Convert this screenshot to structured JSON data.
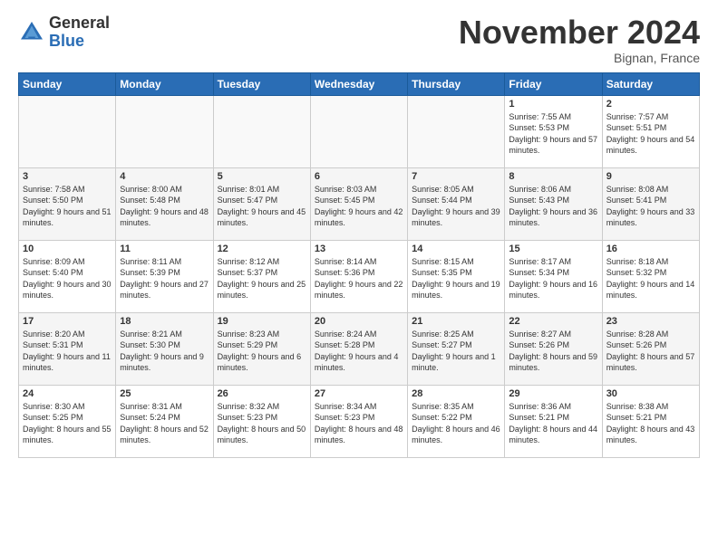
{
  "header": {
    "logo_general": "General",
    "logo_blue": "Blue",
    "month_title": "November 2024",
    "location": "Bignan, France"
  },
  "weekdays": [
    "Sunday",
    "Monday",
    "Tuesday",
    "Wednesday",
    "Thursday",
    "Friday",
    "Saturday"
  ],
  "weeks": [
    [
      {
        "day": "",
        "info": ""
      },
      {
        "day": "",
        "info": ""
      },
      {
        "day": "",
        "info": ""
      },
      {
        "day": "",
        "info": ""
      },
      {
        "day": "",
        "info": ""
      },
      {
        "day": "1",
        "info": "Sunrise: 7:55 AM\nSunset: 5:53 PM\nDaylight: 9 hours and 57 minutes."
      },
      {
        "day": "2",
        "info": "Sunrise: 7:57 AM\nSunset: 5:51 PM\nDaylight: 9 hours and 54 minutes."
      }
    ],
    [
      {
        "day": "3",
        "info": "Sunrise: 7:58 AM\nSunset: 5:50 PM\nDaylight: 9 hours and 51 minutes."
      },
      {
        "day": "4",
        "info": "Sunrise: 8:00 AM\nSunset: 5:48 PM\nDaylight: 9 hours and 48 minutes."
      },
      {
        "day": "5",
        "info": "Sunrise: 8:01 AM\nSunset: 5:47 PM\nDaylight: 9 hours and 45 minutes."
      },
      {
        "day": "6",
        "info": "Sunrise: 8:03 AM\nSunset: 5:45 PM\nDaylight: 9 hours and 42 minutes."
      },
      {
        "day": "7",
        "info": "Sunrise: 8:05 AM\nSunset: 5:44 PM\nDaylight: 9 hours and 39 minutes."
      },
      {
        "day": "8",
        "info": "Sunrise: 8:06 AM\nSunset: 5:43 PM\nDaylight: 9 hours and 36 minutes."
      },
      {
        "day": "9",
        "info": "Sunrise: 8:08 AM\nSunset: 5:41 PM\nDaylight: 9 hours and 33 minutes."
      }
    ],
    [
      {
        "day": "10",
        "info": "Sunrise: 8:09 AM\nSunset: 5:40 PM\nDaylight: 9 hours and 30 minutes."
      },
      {
        "day": "11",
        "info": "Sunrise: 8:11 AM\nSunset: 5:39 PM\nDaylight: 9 hours and 27 minutes."
      },
      {
        "day": "12",
        "info": "Sunrise: 8:12 AM\nSunset: 5:37 PM\nDaylight: 9 hours and 25 minutes."
      },
      {
        "day": "13",
        "info": "Sunrise: 8:14 AM\nSunset: 5:36 PM\nDaylight: 9 hours and 22 minutes."
      },
      {
        "day": "14",
        "info": "Sunrise: 8:15 AM\nSunset: 5:35 PM\nDaylight: 9 hours and 19 minutes."
      },
      {
        "day": "15",
        "info": "Sunrise: 8:17 AM\nSunset: 5:34 PM\nDaylight: 9 hours and 16 minutes."
      },
      {
        "day": "16",
        "info": "Sunrise: 8:18 AM\nSunset: 5:32 PM\nDaylight: 9 hours and 14 minutes."
      }
    ],
    [
      {
        "day": "17",
        "info": "Sunrise: 8:20 AM\nSunset: 5:31 PM\nDaylight: 9 hours and 11 minutes."
      },
      {
        "day": "18",
        "info": "Sunrise: 8:21 AM\nSunset: 5:30 PM\nDaylight: 9 hours and 9 minutes."
      },
      {
        "day": "19",
        "info": "Sunrise: 8:23 AM\nSunset: 5:29 PM\nDaylight: 9 hours and 6 minutes."
      },
      {
        "day": "20",
        "info": "Sunrise: 8:24 AM\nSunset: 5:28 PM\nDaylight: 9 hours and 4 minutes."
      },
      {
        "day": "21",
        "info": "Sunrise: 8:25 AM\nSunset: 5:27 PM\nDaylight: 9 hours and 1 minute."
      },
      {
        "day": "22",
        "info": "Sunrise: 8:27 AM\nSunset: 5:26 PM\nDaylight: 8 hours and 59 minutes."
      },
      {
        "day": "23",
        "info": "Sunrise: 8:28 AM\nSunset: 5:26 PM\nDaylight: 8 hours and 57 minutes."
      }
    ],
    [
      {
        "day": "24",
        "info": "Sunrise: 8:30 AM\nSunset: 5:25 PM\nDaylight: 8 hours and 55 minutes."
      },
      {
        "day": "25",
        "info": "Sunrise: 8:31 AM\nSunset: 5:24 PM\nDaylight: 8 hours and 52 minutes."
      },
      {
        "day": "26",
        "info": "Sunrise: 8:32 AM\nSunset: 5:23 PM\nDaylight: 8 hours and 50 minutes."
      },
      {
        "day": "27",
        "info": "Sunrise: 8:34 AM\nSunset: 5:23 PM\nDaylight: 8 hours and 48 minutes."
      },
      {
        "day": "28",
        "info": "Sunrise: 8:35 AM\nSunset: 5:22 PM\nDaylight: 8 hours and 46 minutes."
      },
      {
        "day": "29",
        "info": "Sunrise: 8:36 AM\nSunset: 5:21 PM\nDaylight: 8 hours and 44 minutes."
      },
      {
        "day": "30",
        "info": "Sunrise: 8:38 AM\nSunset: 5:21 PM\nDaylight: 8 hours and 43 minutes."
      }
    ]
  ]
}
